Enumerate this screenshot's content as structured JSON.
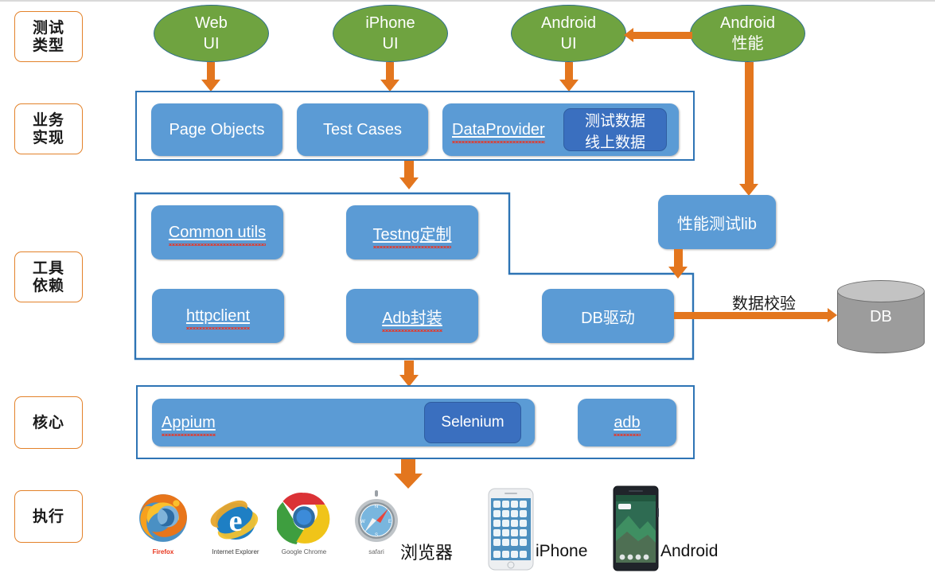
{
  "diagram": {
    "title": "Test Automation Framework Layered Architecture",
    "colors": {
      "accent_orange": "#E3761E",
      "label_border_orange": "#E3822A",
      "container_blue": "#2E74B5",
      "node_blue": "#5B9BD5",
      "node_dark_blue": "#3A6FBF",
      "ellipse_green": "#6FA340",
      "ellipse_outline": "#2E6D8E",
      "db_gray": "#9C9C9C",
      "misspell_red": "#E03B2F"
    }
  },
  "row_labels": [
    {
      "name": "test-type",
      "lines": [
        "测试",
        "类型"
      ]
    },
    {
      "name": "business",
      "lines": [
        "业务",
        "实现"
      ]
    },
    {
      "name": "tools",
      "lines": [
        "工具",
        "依赖"
      ]
    },
    {
      "name": "core",
      "lines": [
        "核心"
      ]
    },
    {
      "name": "execution",
      "lines": [
        "执行"
      ]
    }
  ],
  "test_types": [
    {
      "name": "web-ui",
      "lines": [
        "Web",
        "UI"
      ]
    },
    {
      "name": "iphone-ui",
      "lines": [
        "iPhone",
        "UI"
      ]
    },
    {
      "name": "android-ui",
      "lines": [
        "Android",
        "UI"
      ]
    },
    {
      "name": "android-perf",
      "lines": [
        "Android",
        "性能"
      ]
    }
  ],
  "business_layer": {
    "nodes": [
      {
        "name": "page-objects",
        "label": "Page Objects",
        "misspelled": false
      },
      {
        "name": "test-cases",
        "label": "Test Cases",
        "misspelled": false
      },
      {
        "name": "data-provider",
        "label": "DataProvider",
        "misspelled": true
      }
    ],
    "data_sources": {
      "name": "data-source-split",
      "top": "测试数据",
      "bottom": "线上数据"
    }
  },
  "tools_layer": {
    "nodes": [
      {
        "name": "common-utils",
        "label": "Common utils",
        "misspelled": true
      },
      {
        "name": "testng-custom",
        "label": "Testng定制",
        "misspelled": true
      },
      {
        "name": "httpclient",
        "label": "httpclient",
        "misspelled": true
      },
      {
        "name": "adb-wrapper",
        "label": "Adb封装",
        "misspelled": true
      },
      {
        "name": "db-driver",
        "label": "DB驱动",
        "misspelled": false
      }
    ],
    "perf_lib": {
      "name": "perf-test-lib",
      "label": "性能测试lib"
    },
    "db": {
      "name": "database",
      "label": "DB"
    },
    "db_edge_label": "数据校验"
  },
  "core_layer": {
    "appium": {
      "name": "appium",
      "label": "Appium",
      "misspelled": true
    },
    "selenium": {
      "name": "selenium",
      "label": "Selenium"
    },
    "adb": {
      "name": "adb",
      "label": "adb",
      "misspelled": true
    }
  },
  "execution_layer": {
    "browsers": [
      {
        "name": "firefox-logo",
        "caption": "Firefox",
        "caption_color": "#E8351C"
      },
      {
        "name": "ie-logo",
        "caption": "Internet Explorer",
        "caption_color": "#3a3a3a"
      },
      {
        "name": "chrome-logo",
        "caption": "Google Chrome",
        "caption_color": "#5a5a5a"
      },
      {
        "name": "safari-logo",
        "caption": "safari",
        "caption_color": "#6a6a6a"
      }
    ],
    "browser_group_label": "浏览器",
    "devices": [
      {
        "name": "iphone-device",
        "label": "iPhone"
      },
      {
        "name": "android-device",
        "label": "Android"
      }
    ]
  }
}
